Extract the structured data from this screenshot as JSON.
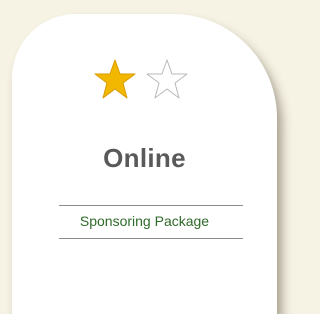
{
  "card": {
    "tier": "Online",
    "package_name": "Sponsoring Package",
    "rating": {
      "filled": 1,
      "total": 2
    },
    "icons": [
      "star-filled-icon",
      "star-outline-icon"
    ],
    "colors": {
      "background": "#f6f2e4",
      "card": "#ffffff",
      "star_fill": "#f2b800",
      "star_outline": "#b8b8b8",
      "title": "#595959",
      "package_text": "#2f6b2a"
    }
  }
}
